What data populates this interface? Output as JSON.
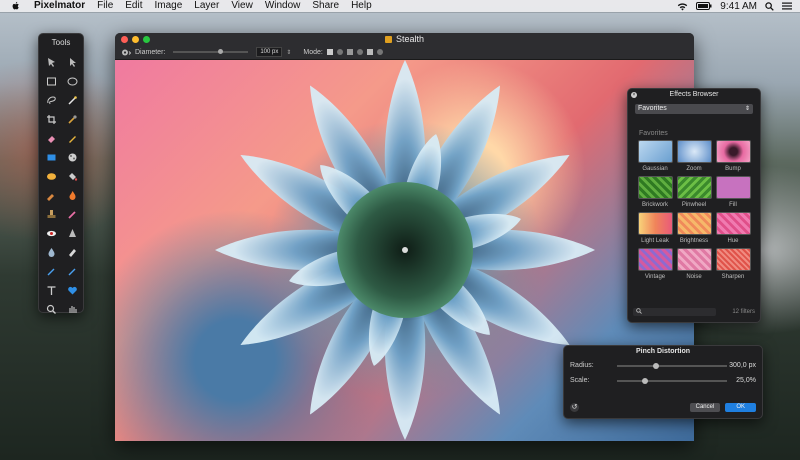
{
  "menubar": {
    "app_name": "Pixelmator",
    "items": [
      "File",
      "Edit",
      "Image",
      "Layer",
      "View",
      "Window",
      "Share",
      "Help"
    ],
    "clock": "9:41 AM"
  },
  "tools": {
    "title": "Tools"
  },
  "window": {
    "title": "Stealth",
    "toolbar": {
      "diameter_label": "Diameter:",
      "diameter_value": "100 px",
      "mode_label": "Mode:"
    }
  },
  "effects_browser": {
    "title": "Effects Browser",
    "category_selected": "Favorites",
    "section_label": "Favorites",
    "filters": [
      {
        "name": "Gaussian",
        "color": "#8fb7dc"
      },
      {
        "name": "Zoom",
        "color": "#6a9ad1"
      },
      {
        "name": "Bump",
        "color": "#e86aa2"
      },
      {
        "name": "Brickwork",
        "color": "#3f8c2f"
      },
      {
        "name": "Pinwheel",
        "color": "#4d9a36"
      },
      {
        "name": "Fill",
        "color": "#c772bf"
      },
      {
        "name": "Light Leak",
        "color": "#f0a05a"
      },
      {
        "name": "Brightness",
        "color": "#f2a46a"
      },
      {
        "name": "Hue",
        "color": "#e86aa2"
      },
      {
        "name": "Vintage",
        "color": "#d45aa0"
      },
      {
        "name": "Noise",
        "color": "#e07aa4"
      },
      {
        "name": "Sharpen",
        "color": "#e0534a"
      }
    ],
    "filter_count": "12 filters"
  },
  "pinch_distortion": {
    "title": "Pinch Distortion",
    "radius_label": "Radius:",
    "radius_value": "300,0 px",
    "radius_level": 0.35,
    "scale_label": "Scale:",
    "scale_value": "25,0%",
    "scale_level": 0.25,
    "cancel_label": "Cancel",
    "ok_label": "OK"
  },
  "colors": {
    "accent": "#1f7fe0",
    "close": "#ff5f57",
    "minimize": "#ffbd2e",
    "zoom": "#28c840"
  }
}
